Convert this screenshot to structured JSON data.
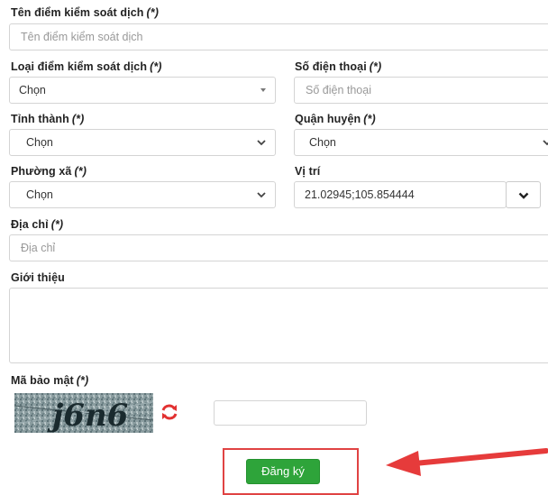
{
  "form": {
    "name": {
      "label": "Tên điểm kiểm soát dịch",
      "required": "(*)",
      "placeholder": "Tên điểm kiểm soát dịch"
    },
    "type": {
      "label": "Loại điểm kiểm soát dịch",
      "required": "(*)",
      "value": "Chọn"
    },
    "phone": {
      "label": "Số điện thoại",
      "required": "(*)",
      "placeholder": "Số điện thoại"
    },
    "province": {
      "label": "Tỉnh thành",
      "required": "(*)",
      "value": "Chọn"
    },
    "district": {
      "label": "Quận huyện",
      "required": "(*)",
      "value": "Chọn"
    },
    "ward": {
      "label": "Phường xã",
      "required": "(*)",
      "value": "Chọn"
    },
    "location": {
      "label": "Vị trí",
      "value": "21.02945;105.854444"
    },
    "address": {
      "label": "Địa chỉ",
      "required": "(*)",
      "placeholder": "Địa chỉ"
    },
    "intro": {
      "label": "Giới thiệu"
    },
    "captcha": {
      "label": "Mã bảo mật",
      "required": "(*)",
      "image_text": "j6n6"
    },
    "submit_label": "Đăng ký"
  },
  "colors": {
    "submit": "#2ea43a",
    "refresh_icon": "#e23131",
    "highlight_box": "#e04343",
    "arrow": "#e63b3b"
  }
}
